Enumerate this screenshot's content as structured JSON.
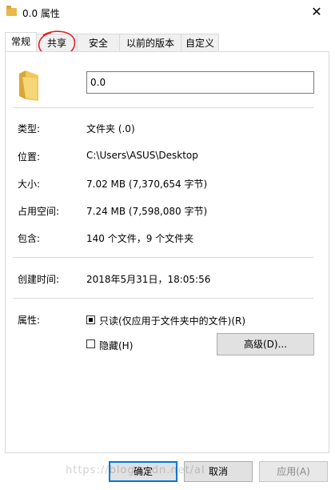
{
  "window": {
    "title": "0.0 属性",
    "close_glyph": "✕",
    "title_icon": "folder-icon"
  },
  "tabs": [
    {
      "label": "常规",
      "active": true
    },
    {
      "label": "共享",
      "active": false
    },
    {
      "label": "安全",
      "active": false
    },
    {
      "label": "以前的版本",
      "active": false
    },
    {
      "label": "自定义",
      "active": false
    }
  ],
  "general": {
    "name_value": "0.0",
    "type": {
      "label": "类型:",
      "value": "文件夹 (.0)"
    },
    "location": {
      "label": "位置:",
      "value": "C:\\Users\\ASUS\\Desktop"
    },
    "size": {
      "label": "大小:",
      "value": "7.02 MB (7,370,654 字节)"
    },
    "size_on_disk": {
      "label": "占用空间:",
      "value": "7.24 MB (7,598,080 字节)"
    },
    "contains": {
      "label": "包含:",
      "value": "140 个文件，9 个文件夹"
    },
    "created": {
      "label": "创建时间:",
      "value": "2018年5月31日，18:05:56"
    },
    "attributes": {
      "label": "属性:",
      "readonly_label": "只读(仅应用于文件夹中的文件)(R)",
      "readonly_checked": true,
      "hidden_label": "隐藏(H)",
      "hidden_checked": false,
      "advanced_label": "高级(D)..."
    }
  },
  "footer": {
    "ok_label": "确定",
    "cancel_label": "取消",
    "apply_label": "应用(A)"
  },
  "watermark": "https://blog.csdn.net/al",
  "colors": {
    "accent": "#0078d7",
    "folder": "#e8b84a",
    "annotation": "#e02020"
  }
}
